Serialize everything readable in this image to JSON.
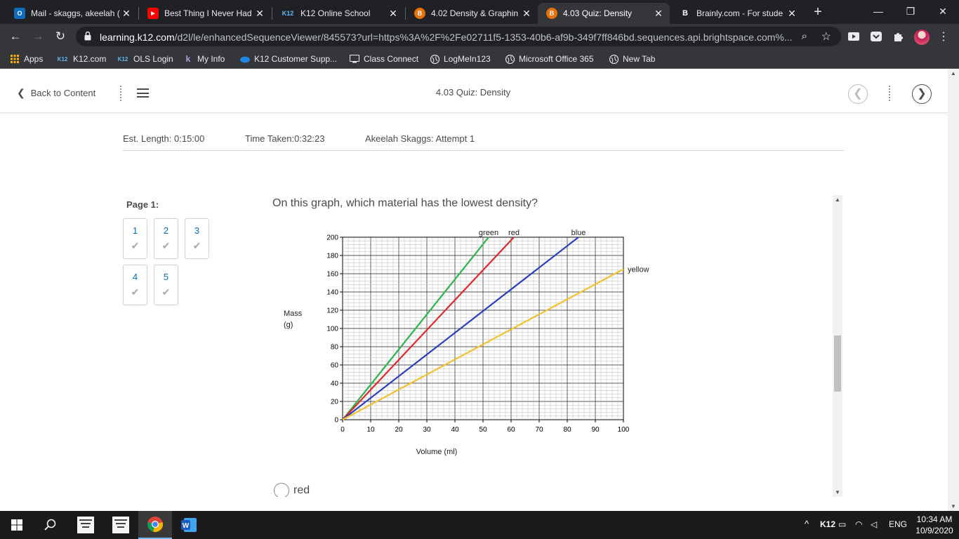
{
  "tabs": [
    {
      "title": "Mail - skaggs, akeelah (",
      "fav": "O",
      "fav_color": "#0f6cbd"
    },
    {
      "title": "Best Thing I Never Had",
      "fav": "▶",
      "fav_color": "#ff0000"
    },
    {
      "title": "K12 Online School",
      "fav": "K12",
      "fav_color": "#1565c0"
    },
    {
      "title": "4.02 Density & Graphin",
      "fav": "B",
      "fav_color": "#e8710a"
    },
    {
      "title": "4.03 Quiz: Density",
      "fav": "B",
      "fav_color": "#e8710a",
      "active": true
    },
    {
      "title": "Brainly.com - For stude",
      "fav": "B",
      "fav_color": "#202124"
    }
  ],
  "address": {
    "host": "learning.k12.com",
    "path": "/d2l/le/enhancedSequenceViewer/845573?url=https%3A%2F%2Fe02711f5-1353-40b6-af9b-349f7ff846bd.sequences.api.brightspace.com%..."
  },
  "bookmarks": [
    {
      "label": "Apps",
      "icon": "apps-icon"
    },
    {
      "label": "K12.com",
      "icon": "k12-icon"
    },
    {
      "label": "OLS Login",
      "icon": "k12-icon"
    },
    {
      "label": "My Info",
      "icon": "k12-swoosh-icon"
    },
    {
      "label": "K12 Customer Supp...",
      "icon": "salesforce-cloud-icon"
    },
    {
      "label": "Class Connect",
      "icon": "class-connect-icon"
    },
    {
      "label": "LogMeIn123",
      "icon": "globe-icon"
    },
    {
      "label": "Microsoft Office 365",
      "icon": "globe-icon"
    },
    {
      "label": "New Tab",
      "icon": "globe-icon"
    }
  ],
  "nav": {
    "back_label": "Back to Content",
    "title": "4.03 Quiz: Density"
  },
  "info": {
    "length": "Est. Length: 0:15:00",
    "taken": "Time Taken:0:32:23",
    "attempt": "Akeelah Skaggs: Attempt 1"
  },
  "quiz": {
    "page_label": "Page 1:",
    "questions": [
      "1",
      "2",
      "3",
      "4",
      "5"
    ],
    "question_text": "On this graph, which material has the lowest density?",
    "answers": [
      "red"
    ]
  },
  "chart_data": {
    "type": "line",
    "xlabel": "Volume (ml)",
    "ylabel_lines": [
      "Mass",
      "(g)"
    ],
    "xlim": [
      0,
      100
    ],
    "ylim": [
      0,
      200
    ],
    "xticks": [
      0,
      10,
      20,
      30,
      40,
      50,
      60,
      70,
      80,
      90,
      100
    ],
    "yticks": [
      0,
      20,
      40,
      60,
      80,
      100,
      120,
      140,
      160,
      180,
      200
    ],
    "grid": true,
    "series": [
      {
        "name": "green",
        "color": "#2bb34a",
        "points": [
          [
            0,
            0
          ],
          [
            52,
            200
          ]
        ]
      },
      {
        "name": "red",
        "color": "#e0282a",
        "points": [
          [
            0,
            0
          ],
          [
            61,
            200
          ]
        ]
      },
      {
        "name": "blue",
        "color": "#2b3fbf",
        "points": [
          [
            0,
            0
          ],
          [
            84,
            200
          ]
        ]
      },
      {
        "name": "yellow",
        "color": "#f2c12e",
        "points": [
          [
            0,
            0
          ],
          [
            100,
            165
          ]
        ]
      }
    ]
  },
  "taskbar": {
    "tray_label": "K12",
    "lang": "ENG",
    "time": "10:34 AM",
    "date": "10/9/2020"
  },
  "colors": {
    "link": "#006fbf",
    "text": "#494c4e",
    "chrome_dark": "#202124",
    "chrome_mid": "#35363a"
  }
}
